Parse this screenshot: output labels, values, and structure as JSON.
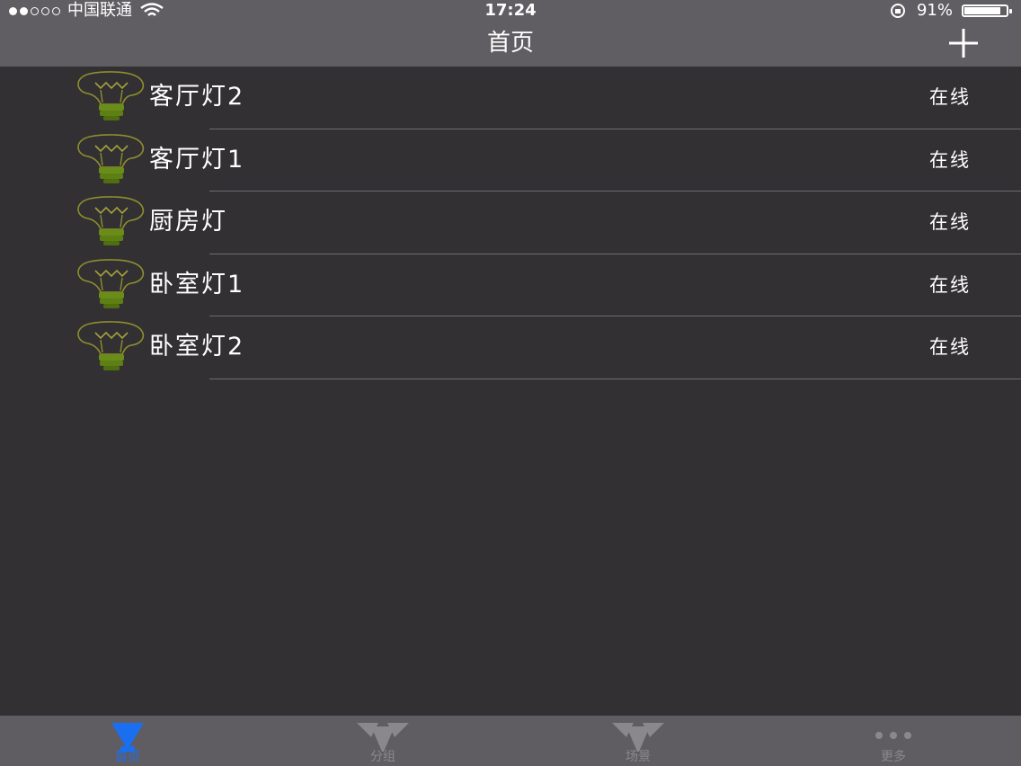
{
  "status_bar": {
    "carrier": "中国联通",
    "time": "17:24",
    "battery_text": "91%",
    "battery_level": 0.91
  },
  "nav": {
    "title": "首页",
    "add_icon": "plus-icon"
  },
  "devices": [
    {
      "name": "客厅灯2",
      "status": "在线",
      "icon": "lightbulb-icon"
    },
    {
      "name": "客厅灯1",
      "status": "在线",
      "icon": "lightbulb-icon"
    },
    {
      "name": "厨房灯",
      "status": "在线",
      "icon": "lightbulb-icon"
    },
    {
      "name": "卧室灯1",
      "status": "在线",
      "icon": "lightbulb-icon"
    },
    {
      "name": "卧室灯2",
      "status": "在线",
      "icon": "lightbulb-icon"
    }
  ],
  "tabs": [
    {
      "label": "首页",
      "icon": "home-icon",
      "active": true
    },
    {
      "label": "分组",
      "icon": "group-icon",
      "active": false
    },
    {
      "label": "场景",
      "icon": "scene-icon",
      "active": false
    },
    {
      "label": "更多",
      "icon": "more-icon",
      "active": false
    }
  ],
  "colors": {
    "background": "#323033",
    "bar": "#605e62",
    "accent": "#1a6ff0",
    "bulb_base": "#6a8d1a",
    "bulb_outline": "#8e8e2c"
  }
}
